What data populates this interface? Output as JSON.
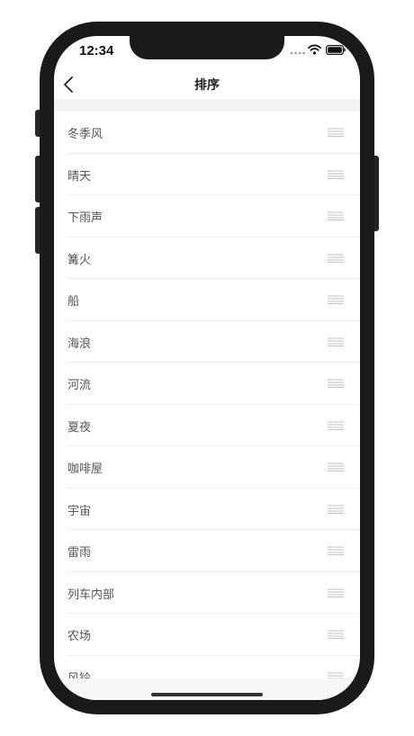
{
  "status_bar": {
    "time": "12:34",
    "icons": [
      "signal-icon",
      "wifi-icon",
      "battery-icon"
    ]
  },
  "nav": {
    "title": "排序",
    "back_icon": "chevron-left-icon"
  },
  "items": [
    {
      "label": "冬季风"
    },
    {
      "label": "晴天"
    },
    {
      "label": "下雨声"
    },
    {
      "label": "篝火"
    },
    {
      "label": "船"
    },
    {
      "label": "海浪"
    },
    {
      "label": "河流"
    },
    {
      "label": "夏夜"
    },
    {
      "label": "咖啡屋"
    },
    {
      "label": "宇宙"
    },
    {
      "label": "雷雨"
    },
    {
      "label": "列车内部"
    },
    {
      "label": "农场"
    },
    {
      "label": "风铃"
    }
  ],
  "colors": {
    "frame": "#1a1a1a",
    "band": "#f3f3f3",
    "item_text": "#555555",
    "handle": "#c2c2c2"
  }
}
